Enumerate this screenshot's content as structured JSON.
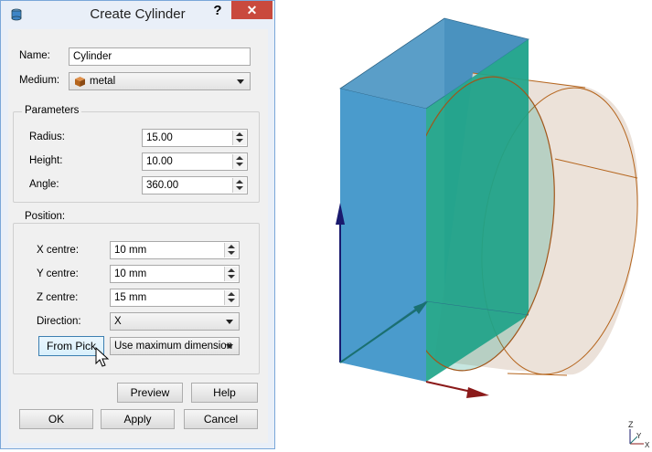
{
  "dialog": {
    "title": "Create Cylinder",
    "help_glyph": "?",
    "close_glyph": "✕",
    "name_label": "Name:",
    "name_value": "Cylinder",
    "medium_label": "Medium:",
    "medium_value": "metal",
    "parameters": {
      "title": "Parameters",
      "radius_label": "Radius:",
      "radius_value": "15.00",
      "height_label": "Height:",
      "height_value": "10.00",
      "angle_label": "Angle:",
      "angle_value": "360.00"
    },
    "position": {
      "title": "Position:",
      "x_label": "X centre:",
      "x_value": "10 mm",
      "y_label": "Y centre:",
      "y_value": "10 mm",
      "z_label": "Z centre:",
      "z_value": "15 mm",
      "direction_label": "Direction:",
      "direction_value": "X",
      "from_pick_label": "From Pick",
      "dimension_value": "Use maximum dimension"
    },
    "buttons": {
      "preview": "Preview",
      "help": "Help",
      "ok": "OK",
      "apply": "Apply",
      "cancel": "Cancel"
    }
  },
  "viewport": {
    "triad": {
      "z": "Z",
      "y": "Y",
      "x": "X"
    }
  },
  "colors": {
    "box_front": "#4a9bcc",
    "box_side": "#1fa58a",
    "cylinder": "#e8dcd2",
    "cylinder_edge": "#b5651d",
    "axis_z": "#1a1a6e",
    "axis_x": "#8b1a1a",
    "close_button": "#c94a3d"
  }
}
